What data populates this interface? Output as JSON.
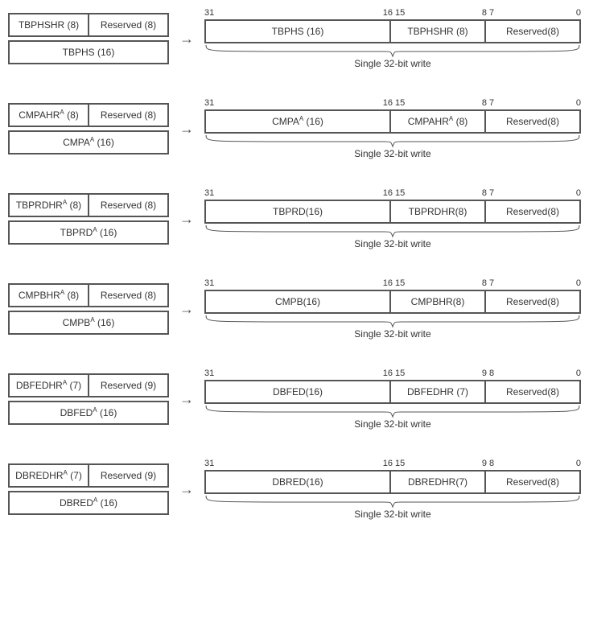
{
  "caption": "Single 32-bit write",
  "rows": [
    {
      "src_hi_hr": "TBPHSHR (8)",
      "src_hi_res": "Reserved (8)",
      "src_lo": "TBPHS (16)",
      "sup_hr": false,
      "sup_lo": false,
      "split_hi": 8,
      "bits": {
        "a": "31",
        "b": "16",
        "c": "15",
        "d": "8",
        "e": "7",
        "f": "0"
      },
      "dst_f1": "TBPHS (16)",
      "dst_f2": "TBPHSHR (8)",
      "dst_f3": "Reserved(8)"
    },
    {
      "src_hi_hr": "CMPAHR",
      "src_hi_hr_tail": " (8)",
      "src_hi_res": "Reserved (8)",
      "src_lo": "CMPA",
      "src_lo_tail": " (16)",
      "sup_hr": true,
      "sup_lo": true,
      "split_hi": 8,
      "bits": {
        "a": "31",
        "b": "16",
        "c": "15",
        "d": "8",
        "e": "7",
        "f": "0"
      },
      "dst_f1": "CMPA",
      "dst_f1_tail": " (16)",
      "dst_f1_sup": true,
      "dst_f2": "CMPAHR",
      "dst_f2_tail": " (8)",
      "dst_f2_sup": true,
      "dst_f3": "Reserved(8)"
    },
    {
      "src_hi_hr": "TBPRDHR",
      "src_hi_hr_tail": " (8)",
      "src_hi_res": "Reserved (8)",
      "src_lo": "TBPRD",
      "src_lo_tail": " (16)",
      "sup_hr": true,
      "sup_lo": true,
      "split_hi": 8,
      "bits": {
        "a": "31",
        "b": "16",
        "c": "15",
        "d": "8",
        "e": "7",
        "f": "0"
      },
      "dst_f1": "TBPRD(16)",
      "dst_f2": "TBPRDHR(8)",
      "dst_f3": "Reserved(8)"
    },
    {
      "src_hi_hr": "CMPBHR",
      "src_hi_hr_tail": " (8)",
      "src_hi_res": "Reserved (8)",
      "src_lo": "CMPB",
      "src_lo_tail": " (16)",
      "sup_hr": true,
      "sup_lo": true,
      "split_hi": 8,
      "bits": {
        "a": "31",
        "b": "16",
        "c": "15",
        "d": "8",
        "e": "7",
        "f": "0"
      },
      "dst_f1": "CMPB(16)",
      "dst_f2": "CMPBHR(8)",
      "dst_f3": "Reserved(8)"
    },
    {
      "src_hi_hr": "DBFEDHR",
      "src_hi_hr_tail": " (7)",
      "src_hi_res": "Reserved (9)",
      "src_lo": "DBFED",
      "src_lo_tail": " (16)",
      "sup_hr": true,
      "sup_lo": true,
      "split_hi": 9,
      "bits": {
        "a": "31",
        "b": "16",
        "c": "15",
        "d": "9",
        "e": "8",
        "f": "0"
      },
      "dst_f1": "DBFED(16)",
      "dst_f2": "DBFEDHR (7)",
      "dst_f3": "Reserved(8)"
    },
    {
      "src_hi_hr": "DBREDHR",
      "src_hi_hr_tail": " (7)",
      "src_hi_res": "Reserved (9)",
      "src_lo": "DBRED",
      "src_lo_tail": " (16)",
      "sup_hr": true,
      "sup_lo": true,
      "split_hi": 9,
      "bits": {
        "a": "31",
        "b": "16",
        "c": "15",
        "d": "9",
        "e": "8",
        "f": "0"
      },
      "dst_f1": "DBRED(16)",
      "dst_f2": "DBREDHR(7)",
      "dst_f3": "Reserved(8)"
    }
  ]
}
